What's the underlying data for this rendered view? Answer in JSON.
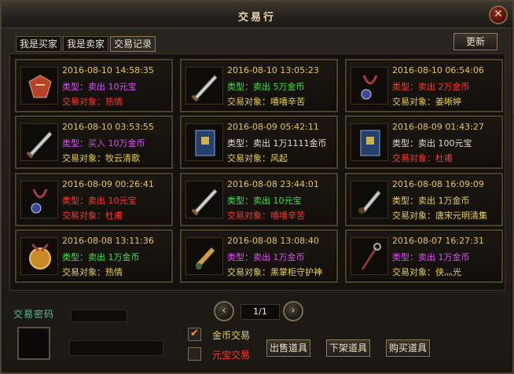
{
  "window": {
    "title": "交易行",
    "close": "✕"
  },
  "tabs": [
    {
      "label": "我是买家",
      "active": false
    },
    {
      "label": "我是卖家",
      "active": false
    },
    {
      "label": "交易记录",
      "active": true
    }
  ],
  "refresh_label": "更新",
  "labels": {
    "type_prefix": "类型：",
    "target_prefix": "交易对象："
  },
  "records": [
    {
      "time": "2016-08-10 14:58:35",
      "action": "卖出",
      "amount": "10元宝",
      "target": "热情",
      "type_color": "#e24bff",
      "target_color": "#ff3a2a",
      "item_icon": "cloth-armor-icon"
    },
    {
      "time": "2016-08-10 13:05:23",
      "action": "卖出",
      "amount": "5万金币",
      "target": "嘻嘻辛苦",
      "type_color": "#3fe13f",
      "target_color": "#e8d24a",
      "item_icon": "sword-icon"
    },
    {
      "time": "2016-08-10 06:54:06",
      "action": "卖出",
      "amount": "2万金币",
      "target": "姜晰婷",
      "type_color": "#ff3a2a",
      "target_color": "#e8d24a",
      "item_icon": "necklace-icon"
    },
    {
      "time": "2016-08-10 03:53:55",
      "action": "买入",
      "amount": "10万金币",
      "target": "牧云清歌",
      "type_color": "#e24bff",
      "target_color": "#e8d24a",
      "item_icon": "sword-icon"
    },
    {
      "time": "2016-08-09 05:42:11",
      "action": "卖出",
      "amount": "1万1111金币",
      "target": "风起",
      "type_color": "#e4dcc8",
      "target_color": "#e8d24a",
      "item_icon": "book-icon"
    },
    {
      "time": "2016-08-09 01:43:27",
      "action": "卖出",
      "amount": "100元宝",
      "target": "杜甫",
      "type_color": "#e4dcc8",
      "target_color": "#ff3a2a",
      "item_icon": "book-icon"
    },
    {
      "time": "2016-08-09 00:26:41",
      "action": "卖出",
      "amount": "10元宝",
      "target": "杜甫",
      "type_color": "#ff3a2a",
      "target_color": "#ff3a2a",
      "item_icon": "necklace-icon"
    },
    {
      "time": "2016-08-08 23:44:01",
      "action": "卖出",
      "amount": "10元宝",
      "target": "嘻嘻辛苦",
      "type_color": "#3fe13f",
      "target_color": "#ff3a2a",
      "item_icon": "sword-icon"
    },
    {
      "time": "2016-08-08 16:09:09",
      "action": "卖出",
      "amount": "1万金币",
      "target": "唐宋元明清集",
      "type_color": "#e8d24a",
      "target_color": "#e8d24a",
      "item_icon": "dagger-icon"
    },
    {
      "time": "2016-08-08 13:11:36",
      "action": "卖出",
      "amount": "1万金币",
      "target": "热情",
      "type_color": "#3fe13f",
      "target_color": "#e8d24a",
      "item_icon": "medal-icon"
    },
    {
      "time": "2016-08-08 13:08:40",
      "action": "卖出",
      "amount": "1万金币",
      "target": "黑掌柜守护神",
      "type_color": "#e24bff",
      "target_color": "#e8d24a",
      "item_icon": "scroll-icon"
    },
    {
      "time": "2016-08-07 16:27:31",
      "action": "卖出",
      "amount": "1万金币",
      "target": "侠灬光",
      "type_color": "#e24bff",
      "target_color": "#e8d24a",
      "item_icon": "staff-icon"
    }
  ],
  "pager": {
    "prev": "‹",
    "next": "›",
    "text": "1/1"
  },
  "password_label": "交易密码",
  "options": [
    {
      "label": "金币交易",
      "checked": true,
      "mark": "✔",
      "color": "#e8d24a"
    },
    {
      "label": "元宝交易",
      "checked": false,
      "mark": "",
      "color": "#ff3a2a"
    }
  ],
  "buttons": {
    "sell": "出售道具",
    "remove": "下架道具",
    "buy": "购买道具"
  },
  "colors": {
    "accent_gold": "#e8c450",
    "border": "#4d4128"
  }
}
